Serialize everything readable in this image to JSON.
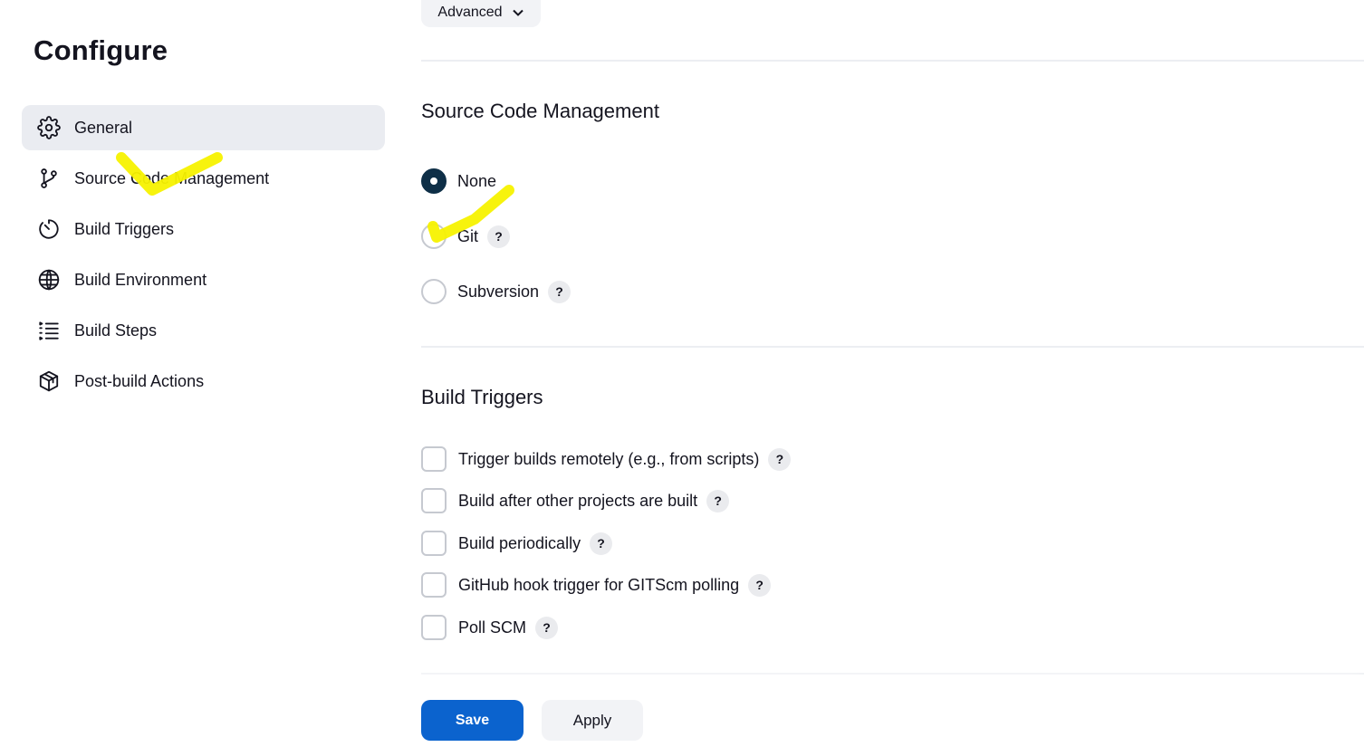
{
  "sidebar": {
    "title": "Configure",
    "items": [
      {
        "label": "General",
        "icon": "gear-icon",
        "active": true
      },
      {
        "label": "Source Code Management",
        "icon": "git-branch-icon",
        "active": false
      },
      {
        "label": "Build Triggers",
        "icon": "timer-icon",
        "active": false
      },
      {
        "label": "Build Environment",
        "icon": "globe-icon",
        "active": false
      },
      {
        "label": "Build Steps",
        "icon": "list-steps-icon",
        "active": false
      },
      {
        "label": "Post-build Actions",
        "icon": "package-icon",
        "active": false
      }
    ]
  },
  "main": {
    "advanced_label": "Advanced",
    "scm": {
      "title": "Source Code Management",
      "options": [
        {
          "label": "None",
          "checked": true,
          "help": false
        },
        {
          "label": "Git",
          "checked": false,
          "help": true
        },
        {
          "label": "Subversion",
          "checked": false,
          "help": true
        }
      ]
    },
    "triggers": {
      "title": "Build Triggers",
      "options": [
        {
          "label": "Trigger builds remotely (e.g., from scripts)",
          "checked": false
        },
        {
          "label": "Build after other projects are built",
          "checked": false
        },
        {
          "label": "Build periodically",
          "checked": false
        },
        {
          "label": "GitHub hook trigger for GITScm polling",
          "checked": false
        },
        {
          "label": "Poll SCM",
          "checked": false
        }
      ]
    },
    "help_glyph": "?"
  },
  "footer": {
    "save_label": "Save",
    "apply_label": "Apply"
  },
  "colors": {
    "primary": "#0b63ce",
    "radio_checked": "#0e2f47",
    "active_nav_bg": "#eaecf1",
    "highlighter": "#f7f200"
  }
}
